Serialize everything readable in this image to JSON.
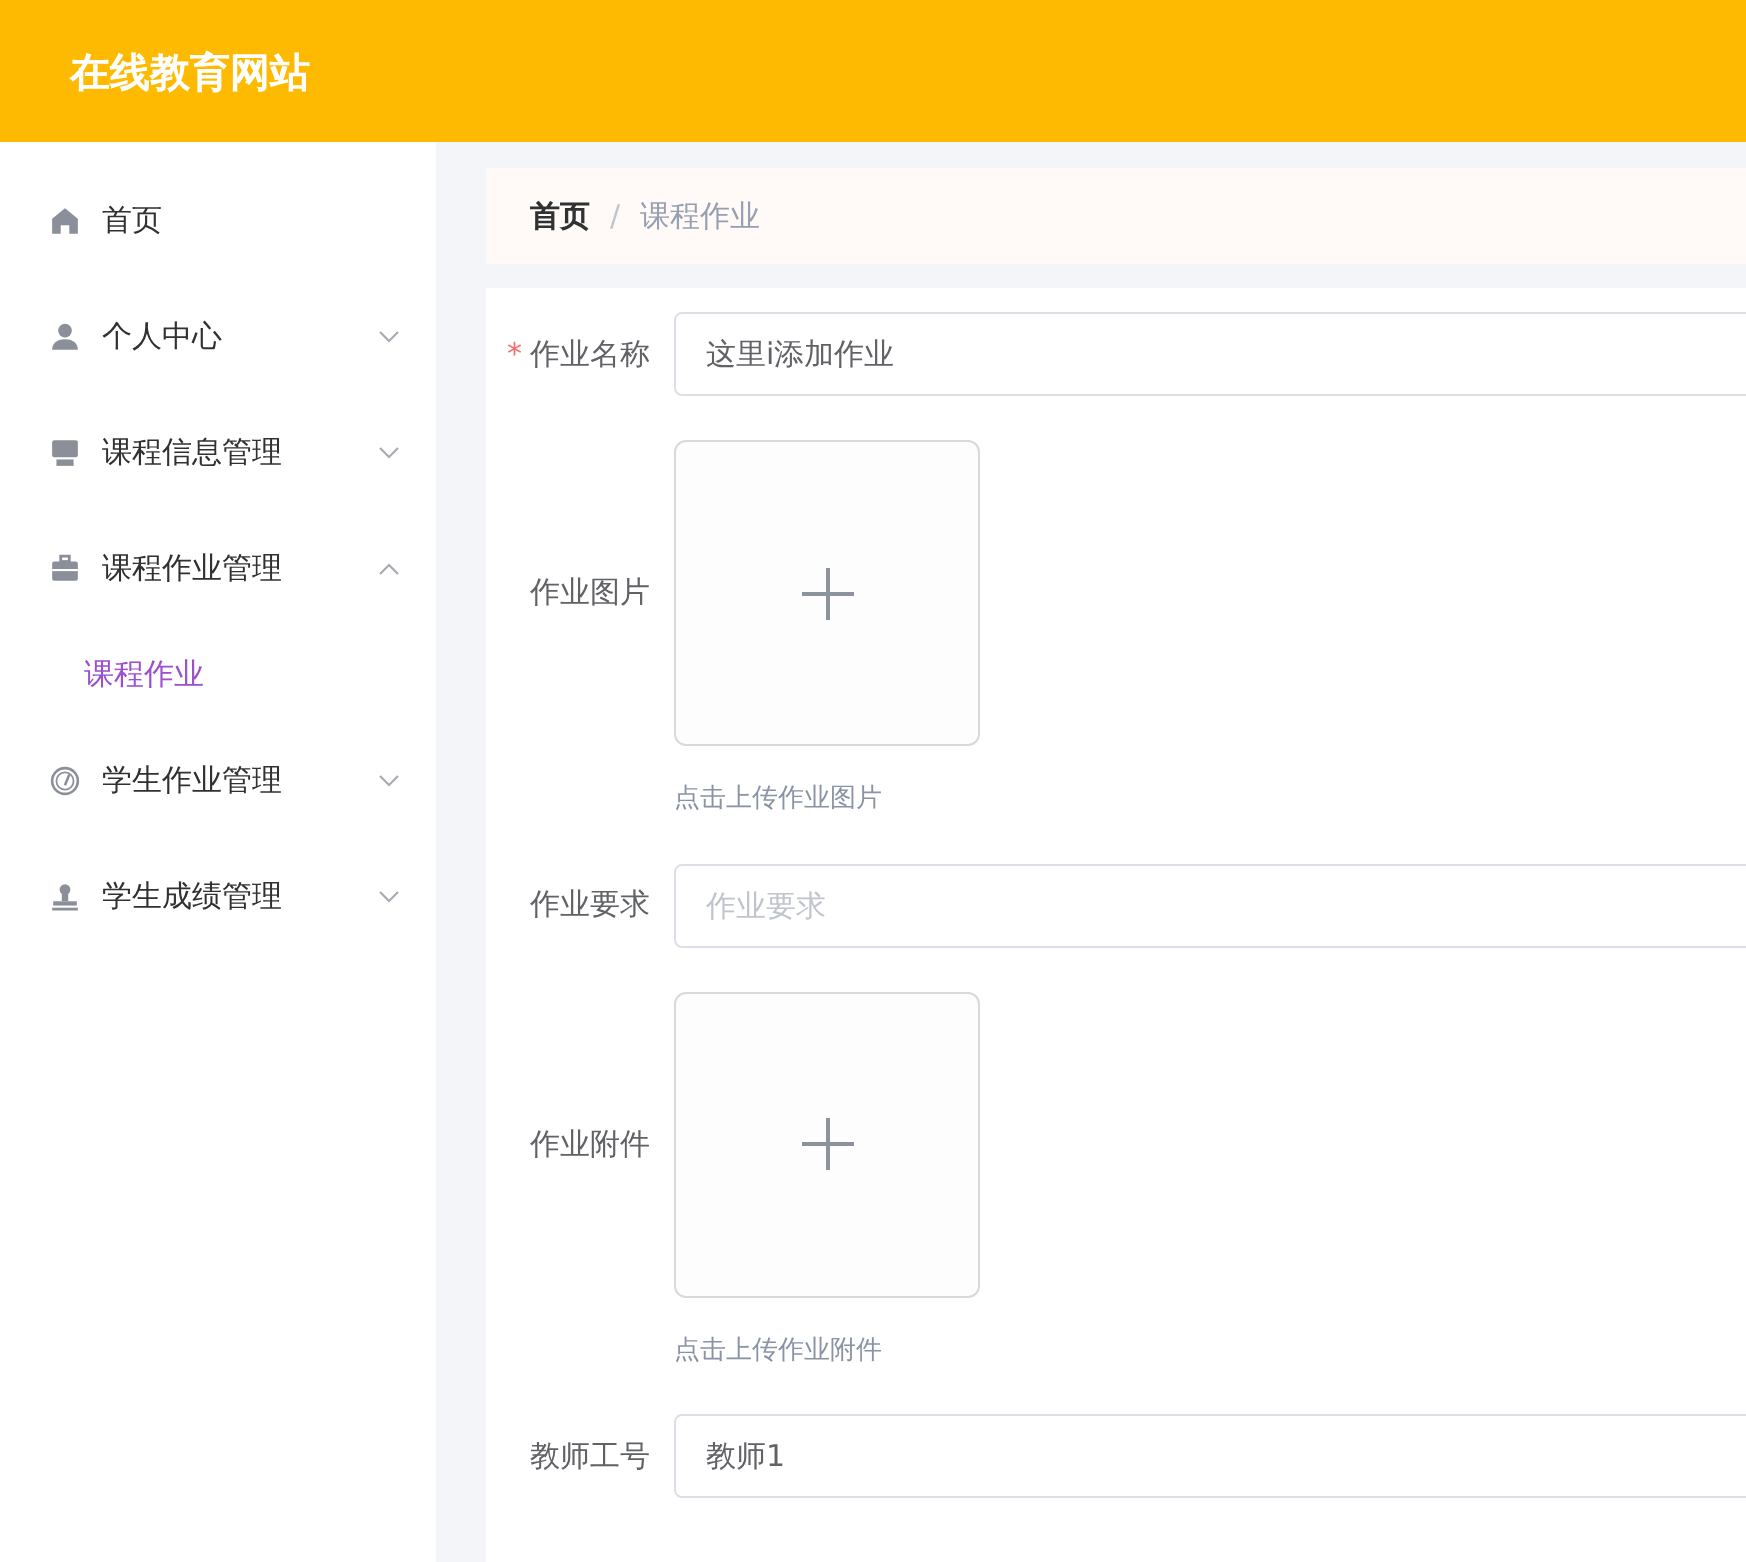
{
  "header": {
    "title": "在线教育网站"
  },
  "sidebar": {
    "items": [
      {
        "label": "首页",
        "kind": "link",
        "selected": false
      },
      {
        "label": "个人中心",
        "kind": "menu",
        "expanded": false,
        "selected": false
      },
      {
        "label": "课程信息管理",
        "kind": "menu",
        "expanded": false,
        "selected": false
      },
      {
        "label": "课程作业管理",
        "kind": "menu",
        "expanded": true,
        "selected": false,
        "children": [
          {
            "label": "课程作业",
            "selected": true
          }
        ]
      },
      {
        "label": "学生作业管理",
        "kind": "menu",
        "expanded": false,
        "selected": false
      },
      {
        "label": "学生成绩管理",
        "kind": "menu",
        "expanded": false,
        "selected": false
      }
    ]
  },
  "breadcrumb_separator": "/",
  "breadcrumb": [
    {
      "label": "首页",
      "current": false
    },
    {
      "label": "课程作业",
      "current": true
    }
  ],
  "form": {
    "required_mark": "*",
    "fields": [
      {
        "kind": "text",
        "label": "作业名称",
        "required": true,
        "value": "这里i添加作业"
      },
      {
        "kind": "upload",
        "label": "作业图片",
        "required": false,
        "hint": "点击上传作业图片"
      },
      {
        "kind": "text",
        "label": "作业要求",
        "required": false,
        "placeholder": "作业要求"
      },
      {
        "kind": "upload",
        "label": "作业附件",
        "required": false,
        "hint": "点击上传作业附件"
      },
      {
        "kind": "text",
        "label": "教师工号",
        "required": false,
        "value": "教师1"
      }
    ]
  }
}
